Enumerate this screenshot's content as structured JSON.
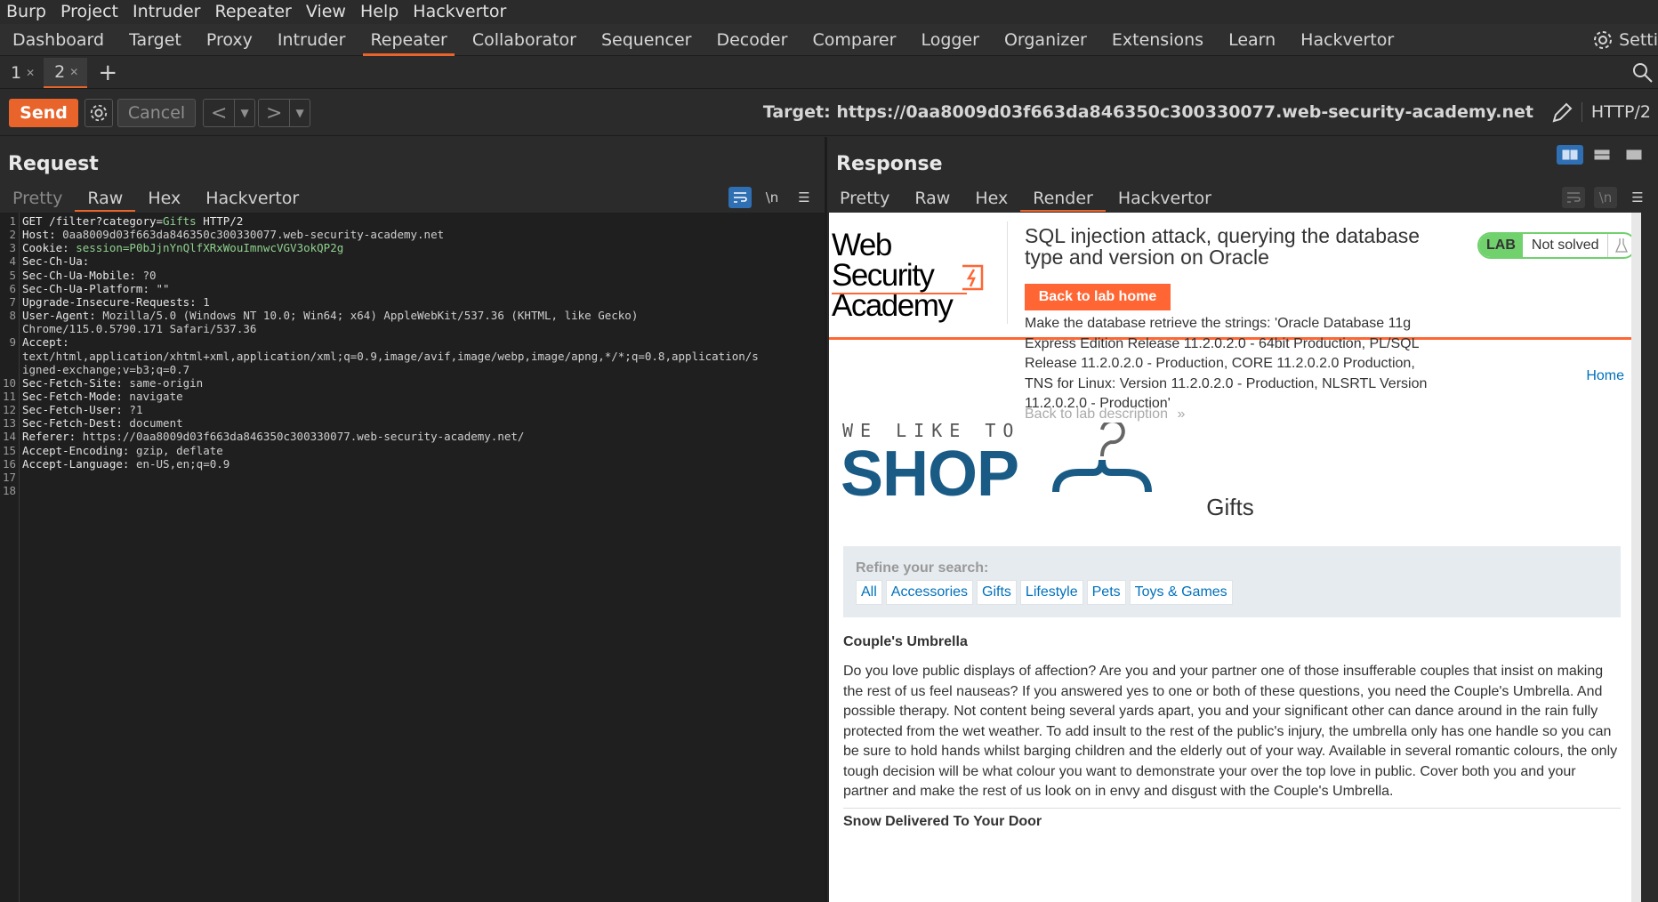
{
  "menubar": [
    "Burp",
    "Project",
    "Intruder",
    "Repeater",
    "View",
    "Help",
    "Hackvertor"
  ],
  "main_tabs": [
    "Dashboard",
    "Target",
    "Proxy",
    "Intruder",
    "Repeater",
    "Collaborator",
    "Sequencer",
    "Decoder",
    "Comparer",
    "Logger",
    "Organizer",
    "Extensions",
    "Learn",
    "Hackvertor"
  ],
  "main_tabs_active": "Repeater",
  "settings_label": "Setti",
  "repeater_tabs": [
    {
      "label": "1",
      "active": false
    },
    {
      "label": "2",
      "active": true
    }
  ],
  "toolbar": {
    "send": "Send",
    "cancel": "Cancel",
    "target": "Target: https://0aa8009d03f663da846350c300330077.web-security-academy.net",
    "protocol": "HTTP/2"
  },
  "request": {
    "title": "Request",
    "tabs": [
      "Pretty",
      "Raw",
      "Hex",
      "Hackvertor"
    ],
    "active_tab": "Raw",
    "newline_label": "\\n",
    "lines": [
      {
        "n": "1",
        "k": "GET /filter?category=",
        "v": "Gifts",
        "s": " HTTP/2"
      },
      {
        "n": "2",
        "k": "Host: ",
        "v": "0aa8009d03f663da846350c300330077.web-security-academy.net"
      },
      {
        "n": "3",
        "k": "Cookie: ",
        "v": "session=P0bJjnYnQlfXRxWouImnwcVGV3okQP2g"
      },
      {
        "n": "4",
        "k": "Sec-Ch-Ua: ",
        "v": ""
      },
      {
        "n": "5",
        "k": "Sec-Ch-Ua-Mobile: ",
        "v": "?0"
      },
      {
        "n": "6",
        "k": "Sec-Ch-Ua-Platform: ",
        "v": "\"\""
      },
      {
        "n": "7",
        "k": "Upgrade-Insecure-Requests: ",
        "v": "1"
      },
      {
        "n": "8",
        "k": "User-Agent: ",
        "v": "Mozilla/5.0 (Windows NT 10.0; Win64; x64) AppleWebKit/537.36 (KHTML, like Gecko)"
      },
      {
        "n": "",
        "k": "",
        "v": "Chrome/115.0.5790.171 Safari/537.36"
      },
      {
        "n": "9",
        "k": "Accept: ",
        "v": ""
      },
      {
        "n": "",
        "k": "",
        "v": "text/html,application/xhtml+xml,application/xml;q=0.9,image/avif,image/webp,image/apng,*/*;q=0.8,application/s"
      },
      {
        "n": "",
        "k": "",
        "v": "igned-exchange;v=b3;q=0.7"
      },
      {
        "n": "10",
        "k": "Sec-Fetch-Site: ",
        "v": "same-origin"
      },
      {
        "n": "11",
        "k": "Sec-Fetch-Mode: ",
        "v": "navigate"
      },
      {
        "n": "12",
        "k": "Sec-Fetch-User: ",
        "v": "?1"
      },
      {
        "n": "13",
        "k": "Sec-Fetch-Dest: ",
        "v": "document"
      },
      {
        "n": "14",
        "k": "Referer: ",
        "v": "https://0aa8009d03f663da846350c300330077.web-security-academy.net/"
      },
      {
        "n": "15",
        "k": "Accept-Encoding: ",
        "v": "gzip, deflate"
      },
      {
        "n": "16",
        "k": "Accept-Language: ",
        "v": "en-US,en;q=0.9"
      },
      {
        "n": "17",
        "k": "",
        "v": ""
      },
      {
        "n": "18",
        "k": "",
        "v": ""
      }
    ]
  },
  "response": {
    "title": "Response",
    "tabs": [
      "Pretty",
      "Raw",
      "Hex",
      "Render",
      "Hackvertor"
    ],
    "active_tab": "Render",
    "newline_label": "\\n"
  },
  "rendered_page": {
    "logo_line1": "Web Security",
    "logo_line2": "Academy",
    "lab_title": "SQL injection attack, querying the database type and version on Oracle",
    "lab_badge": "LAB",
    "lab_status": "Not solved",
    "back_button": "Back to lab home",
    "objective": "Make the database retrieve the strings: 'Oracle Database 11g Express Edition Release 11.2.0.2.0 - 64bit Production, PL/SQL Release 11.2.0.2.0 - Production, CORE 11.2.0.2.0 Production, TNS for Linux: Version 11.2.0.2.0 - Production, NLSRTL Version 11.2.0.2.0 - Production'",
    "back_description": "Back to lab description",
    "home_link": "Home",
    "shop_line1": "WE LIKE TO",
    "shop_line2": "SHOP",
    "category_heading": "Gifts",
    "refine_label": "Refine your search:",
    "filters": [
      "All",
      "Accessories",
      "Gifts",
      "Lifestyle",
      "Pets",
      "Toys & Games"
    ],
    "products": [
      {
        "name": "Couple's Umbrella",
        "description": "Do you love public displays of affection? Are you and your partner one of those insufferable couples that insist on making the rest of us feel nauseas? If you answered yes to one or both of these questions, you need the Couple's Umbrella. And possible therapy. Not content being several yards apart, you and your significant other can dance around in the rain fully protected from the wet weather. To add insult to the rest of the public's injury, the umbrella only has one handle so you can be sure to hold hands whilst barging children and the elderly out of your way. Available in several romantic colours, the only tough decision will be what colour you want to demonstrate your over the top love in public. Cover both you and your partner and make the rest of us look on in envy and disgust with the Couple's Umbrella."
      },
      {
        "name": "Snow Delivered To Your Door",
        "description": ""
      }
    ]
  },
  "colors": {
    "accent": "#e8642b",
    "shop_blue": "#1a5b86",
    "link_blue": "#0071bc",
    "lab_green": "#70d16d"
  }
}
